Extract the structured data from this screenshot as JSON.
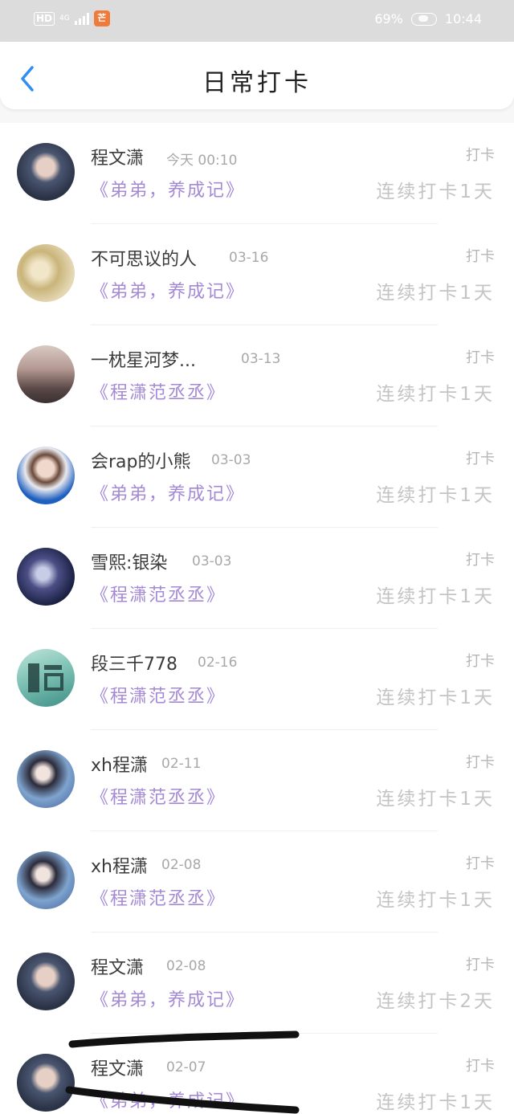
{
  "status": {
    "battery": "69%",
    "time": "10:44",
    "net": "4G",
    "app_badge": "芒"
  },
  "nav": {
    "title": "日常打卡"
  },
  "colors": {
    "accent": "#a489d6",
    "back": "#2f8ef0",
    "muted": "#c4c4c4"
  },
  "items": [
    {
      "name": "程文潇",
      "time": "今天 00:10",
      "book": "《弟弟，养成记》",
      "label": "打卡",
      "streak": "连续打卡1天",
      "avatar": "avatar-a"
    },
    {
      "name": "不可思议的人",
      "time": "03-16",
      "book": "《弟弟，养成记》",
      "label": "打卡",
      "streak": "连续打卡1天",
      "avatar": "avatar-b"
    },
    {
      "name": "一枕星河梦...",
      "time": "03-13",
      "book": "《程潇范丞丞》",
      "label": "打卡",
      "streak": "连续打卡1天",
      "avatar": "avatar-c"
    },
    {
      "name": "会rap的小熊",
      "time": "03-03",
      "book": "《弟弟，养成记》",
      "label": "打卡",
      "streak": "连续打卡1天",
      "avatar": "avatar-d"
    },
    {
      "name": "雪熙:银染",
      "time": "03-03",
      "book": "《程潇范丞丞》",
      "label": "打卡",
      "streak": "连续打卡1天",
      "avatar": "avatar-e"
    },
    {
      "name": "段三千778",
      "time": "02-16",
      "book": "《程潇范丞丞》",
      "label": "打卡",
      "streak": "连续打卡1天",
      "avatar": "avatar-f"
    },
    {
      "name": "xh程潇",
      "time": "02-11",
      "book": "《程潇范丞丞》",
      "label": "打卡",
      "streak": "连续打卡1天",
      "avatar": "avatar-g"
    },
    {
      "name": "xh程潇",
      "time": "02-08",
      "book": "《程潇范丞丞》",
      "label": "打卡",
      "streak": "连续打卡1天",
      "avatar": "avatar-g"
    },
    {
      "name": "程文潇",
      "time": "02-08",
      "book": "《弟弟，养成记》",
      "label": "打卡",
      "streak": "连续打卡2天",
      "avatar": "avatar-a"
    },
    {
      "name": "程文潇",
      "time": "02-07",
      "book": "《弟弟，养成记》",
      "label": "打卡",
      "streak": "连续打卡1天",
      "avatar": "avatar-a"
    }
  ]
}
